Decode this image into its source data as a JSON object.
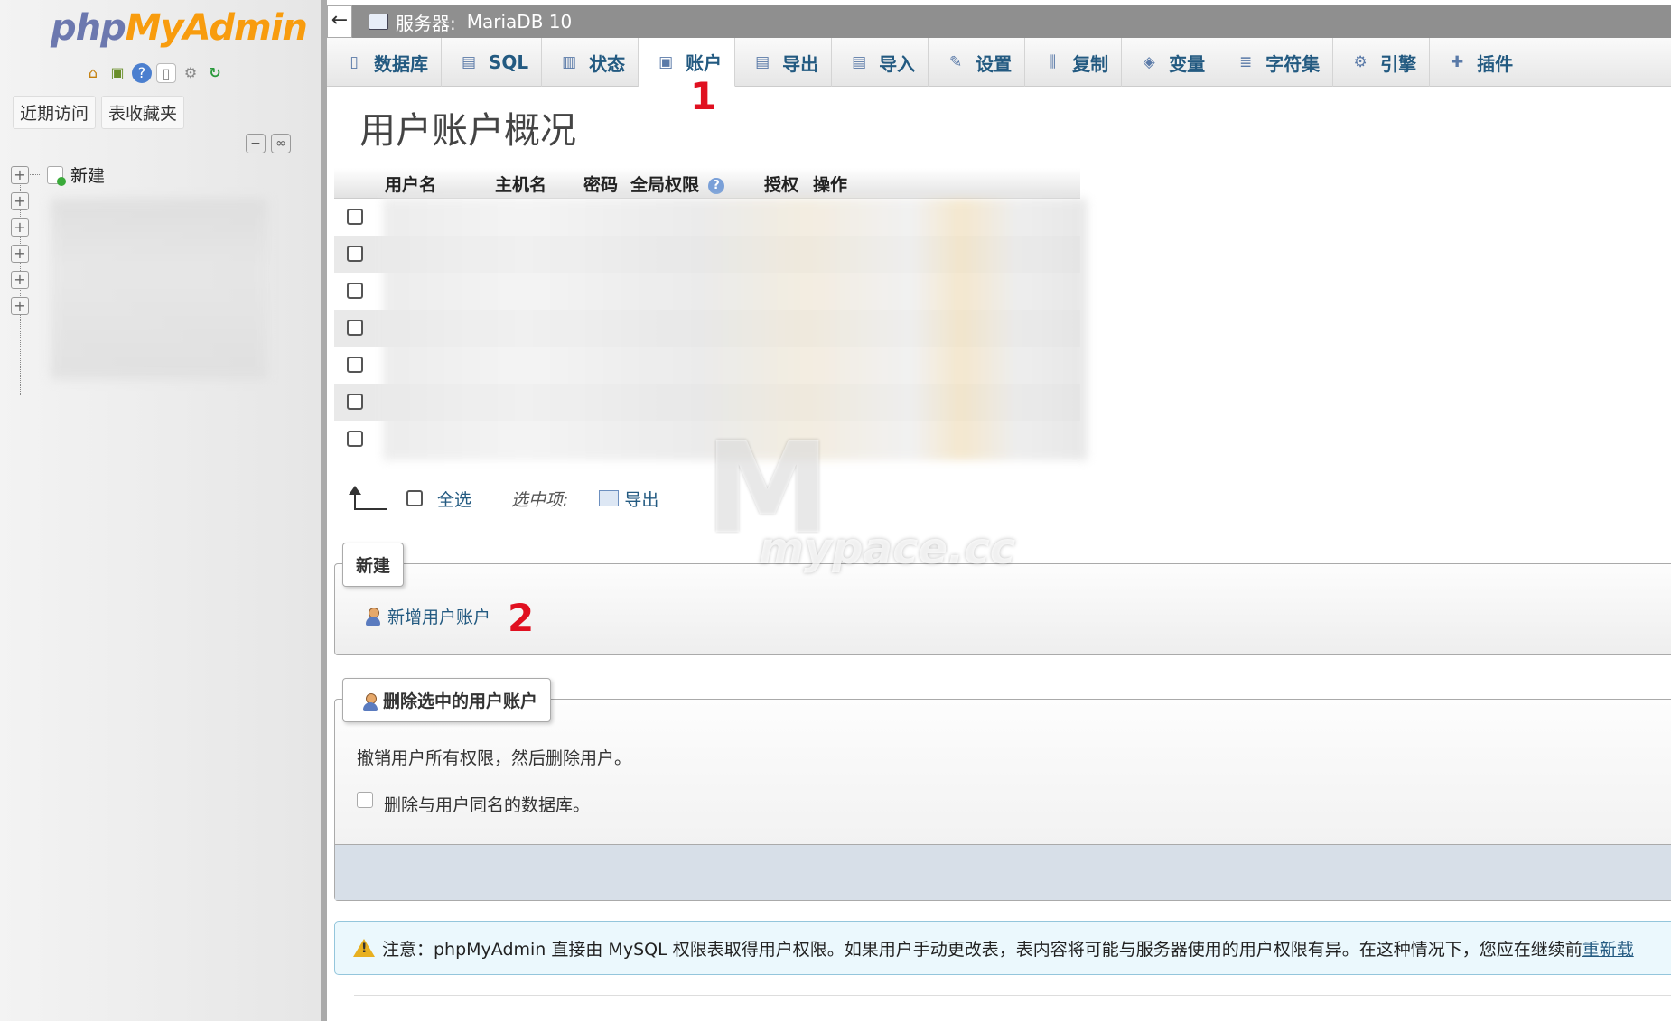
{
  "sidebar": {
    "logo": {
      "php": "php",
      "my": "My",
      "admin": "Admin"
    },
    "quick_icons": [
      "home-icon",
      "database-icon",
      "help-icon",
      "docs-icon",
      "settings-icon",
      "reload-icon"
    ],
    "tabs": [
      {
        "label": "近期访问"
      },
      {
        "label": "表收藏夹"
      }
    ],
    "tree_tools": [
      "collapse-all-icon",
      "link-icon"
    ],
    "tree": {
      "new_label": "新建",
      "expanders": 6
    }
  },
  "serverbar": {
    "back_glyph": "←",
    "server_label": "服务器:",
    "server_name": "MariaDB 10"
  },
  "topmenu": {
    "items": [
      {
        "label": "数据库",
        "icon": "database-icon",
        "glyph": "▯"
      },
      {
        "label": "SQL",
        "icon": "sql-icon",
        "glyph": "▤"
      },
      {
        "label": "状态",
        "icon": "status-icon",
        "glyph": "▥"
      },
      {
        "label": "账户",
        "icon": "accounts-icon",
        "glyph": "▣",
        "active": true
      },
      {
        "label": "导出",
        "icon": "export-icon",
        "glyph": "▤"
      },
      {
        "label": "导入",
        "icon": "import-icon",
        "glyph": "▤"
      },
      {
        "label": "设置",
        "icon": "wrench-icon",
        "glyph": "✎"
      },
      {
        "label": "复制",
        "icon": "replication-icon",
        "glyph": "⫼"
      },
      {
        "label": "变量",
        "icon": "variables-icon",
        "glyph": "◈"
      },
      {
        "label": "字符集",
        "icon": "charset-icon",
        "glyph": "≣"
      },
      {
        "label": "引擎",
        "icon": "engine-icon",
        "glyph": "⚙"
      },
      {
        "label": "插件",
        "icon": "plugin-icon",
        "glyph": "✚"
      }
    ]
  },
  "annotations": {
    "marker1": "1",
    "marker2": "2"
  },
  "main": {
    "title": "用户账户概况",
    "table": {
      "headers": [
        "用户名",
        "主机名",
        "密码",
        "全局权限",
        "授权",
        "操作"
      ],
      "row_count": 7
    },
    "with_selected": {
      "check_all": "全选",
      "label": "选中项:",
      "export": "导出"
    },
    "new_section": {
      "legend": "新建",
      "add_user": "新增用户账户"
    },
    "delete_section": {
      "legend": "删除选中的用户账户",
      "description": "撤销用户所有权限，然后删除用户。",
      "drop_db_label": "删除与用户同名的数据库。"
    },
    "notice": {
      "text": "注意：phpMyAdmin 直接由 MySQL 权限表取得用户权限。如果用户手动更改表，表内容将可能与服务器使用的用户权限有异。在这种情况下，您应在继续前",
      "link": "重新载"
    },
    "watermark": {
      "big": "M",
      "small": "mypace.cc"
    }
  }
}
